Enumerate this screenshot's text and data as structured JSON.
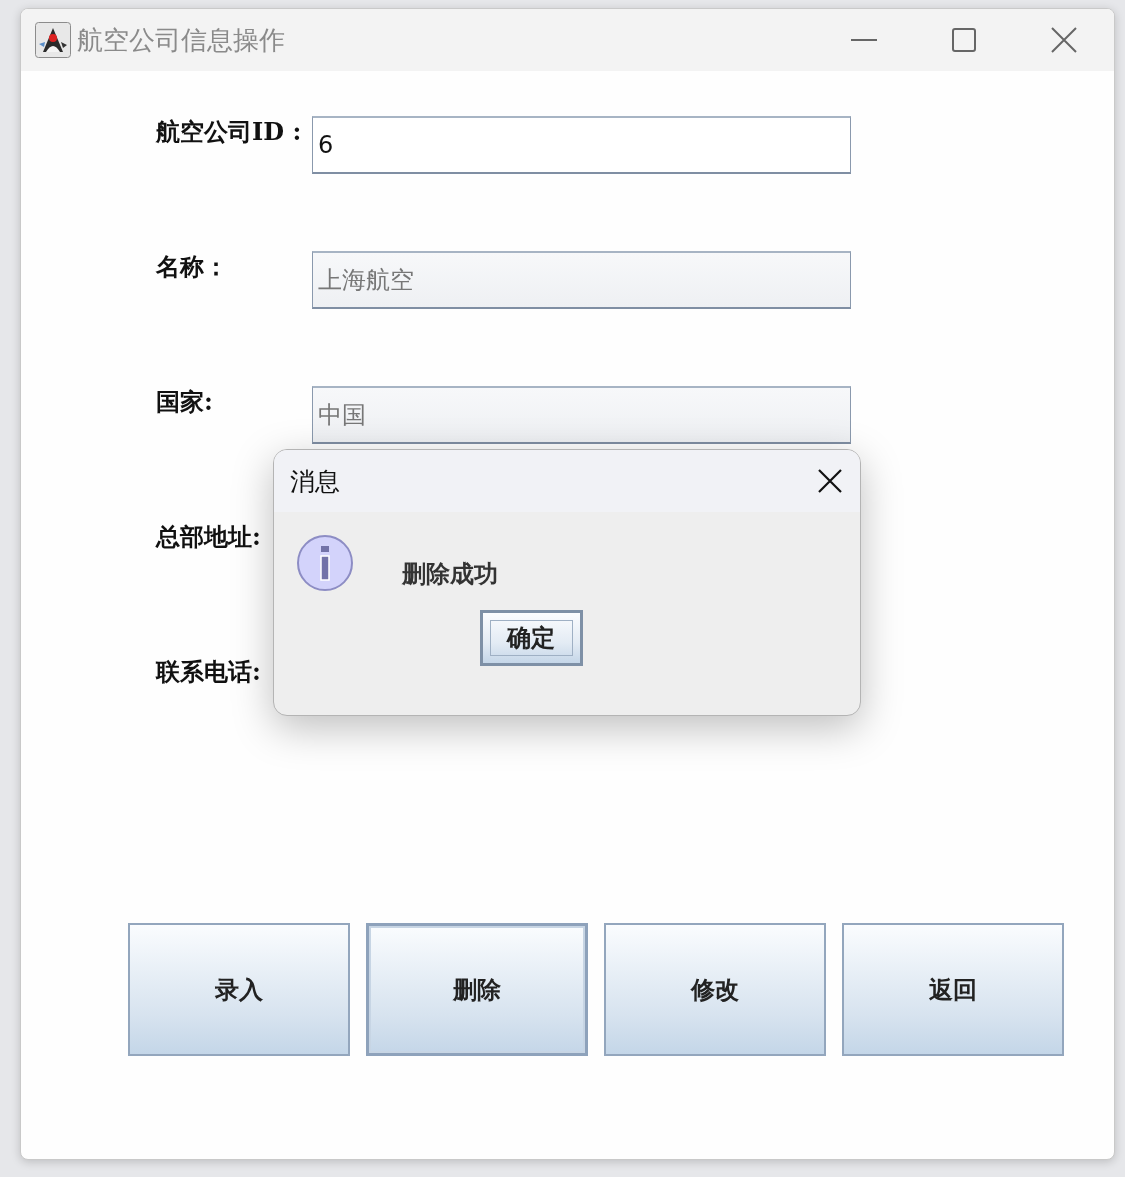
{
  "window": {
    "title": "航空公司信息操作"
  },
  "fields": [
    {
      "label": "航空公司ID :",
      "value": "6",
      "disabled": false
    },
    {
      "label": "名称：",
      "value": "上海航空",
      "disabled": true
    },
    {
      "label": "国家:",
      "value": "中国",
      "disabled": true
    },
    {
      "label": "总部地址:"
    },
    {
      "label": "联系电话:"
    }
  ],
  "buttons": [
    {
      "label": "录入",
      "focused": false
    },
    {
      "label": "删除",
      "focused": true
    },
    {
      "label": "修改",
      "focused": false
    },
    {
      "label": "返回",
      "focused": false
    }
  ],
  "dialog": {
    "title": "消息",
    "message": "删除成功",
    "button": "确定"
  }
}
